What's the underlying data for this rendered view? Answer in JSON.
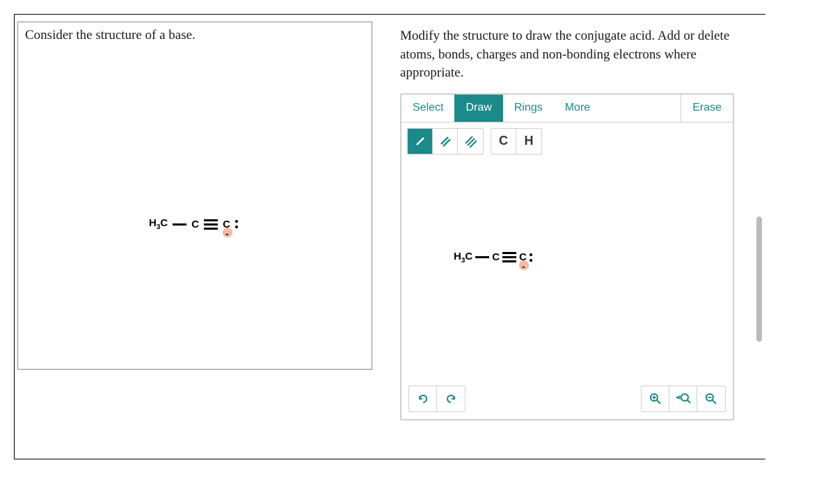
{
  "left": {
    "title": "Consider the structure of a base.",
    "molecule": {
      "atoms": [
        "H3C",
        "C",
        "C"
      ],
      "bonds": [
        "single",
        "triple"
      ],
      "terminal_charge": "negative",
      "lone_pairs_on_terminal": 1
    }
  },
  "right": {
    "instructions": "Modify the structure to draw the conjugate acid. Add or delete atoms, bonds, charges and non-bonding electrons where appropriate.",
    "tabs": {
      "select": "Select",
      "draw": "Draw",
      "rings": "Rings",
      "more": "More",
      "erase": "Erase",
      "active": "draw"
    },
    "bond_tools": {
      "single": "/",
      "double": "//",
      "triple": "///",
      "active": "single"
    },
    "atom_tools": {
      "carbon": "C",
      "hydrogen": "H"
    },
    "canvas_molecule": {
      "atoms": [
        "H3C",
        "C",
        "C"
      ],
      "bonds": [
        "single",
        "triple"
      ],
      "terminal_charge": "negative",
      "lone_pairs_on_terminal": 1
    },
    "controls": {
      "undo": "undo",
      "redo": "redo",
      "zoom_in": "zoom-in",
      "zoom_reset": "zoom-reset",
      "zoom_out": "zoom-out"
    }
  }
}
